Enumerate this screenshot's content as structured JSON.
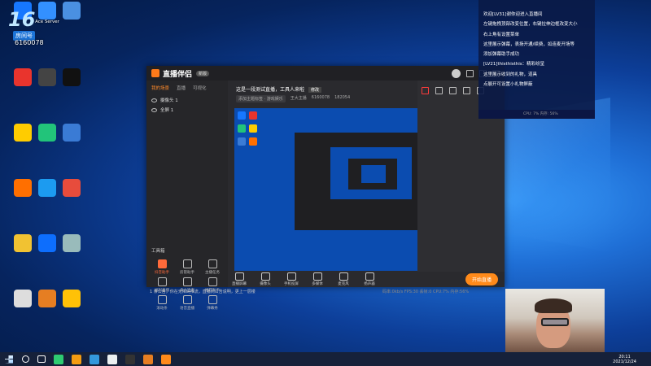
{
  "desktop_icons": [
    {
      "label": "",
      "color": "#1677ff"
    },
    {
      "label": "Ace Server",
      "color": "#3390ff"
    },
    {
      "label": "",
      "color": "#4a90e2"
    },
    {
      "label": "",
      "color": "#e9342d"
    },
    {
      "label": "",
      "color": "#444"
    },
    {
      "label": "",
      "color": "#111"
    },
    {
      "label": "",
      "color": "#ffcc00"
    },
    {
      "label": "",
      "color": "#22c47a"
    },
    {
      "label": "",
      "color": "#3a7bd5"
    },
    {
      "label": "",
      "color": "#ff6f00"
    },
    {
      "label": "",
      "color": "#1c9bf0"
    },
    {
      "label": "",
      "color": "#e74c3c"
    },
    {
      "label": "",
      "color": "#f1c232"
    },
    {
      "label": "",
      "color": "#0d6efd"
    },
    {
      "label": "",
      "color": "#9bb"
    },
    {
      "label": "",
      "color": "#ddd"
    },
    {
      "label": "",
      "color": "#e67e22"
    },
    {
      "label": "",
      "color": "#ffc107"
    }
  ],
  "overlay": {
    "number": "16",
    "tag": "房间号",
    "id": "6160078"
  },
  "app": {
    "name": "直播伴侣",
    "version_tag": "新版",
    "tabs": [
      "我的场景",
      "直播",
      "可视化"
    ],
    "scenes": [
      "摄像头 1",
      "全屏 1"
    ],
    "toolbox_title": "工具箱",
    "tools": [
      {
        "label": "抖音助手",
        "hot": true
      },
      {
        "label": "房管助手",
        "hot": false
      },
      {
        "label": "主播任务",
        "hot": false
      },
      {
        "label": "福利直播",
        "hot": false
      },
      {
        "label": "多人连麦",
        "hot": false
      },
      {
        "label": "推荐助手",
        "hot": false
      },
      {
        "label": "滚动条",
        "hot": false
      },
      {
        "label": "语音直播",
        "hot": false
      },
      {
        "label": "弹幕秀",
        "hot": false
      }
    ],
    "live_title": "这是一段测试直播，工具人来啦",
    "edit_label": "修改",
    "meta": [
      "添加主题标签 · 游戏娱乐",
      "王大主播",
      "6160078",
      "182054"
    ],
    "bottom_buttons": [
      "直播屏幕",
      "摄像头",
      "手机投屏",
      "多媒体",
      "麦克风",
      "扬声器"
    ],
    "start_label": "开始直播",
    "status_left": "1 条公告，你在无障碍推流，直播间公告说明，更上一层楼",
    "status_right": "码率:0kb/s  FPS:30  丢帧:0  CPU:7%  内存:56%"
  },
  "chat": {
    "lines": [
      "欢迎[LV31]谢你迎进入直播间",
      "左键拖拽顶部改变位置，右键拉伸边框改变大小",
      "右上角有设置菜单",
      "这里展示弹幕，表扬开通/续费，如连麦开场等",
      "添加弹幕助手成功",
      "[LV21]thisthisthis：精彩纷呈",
      "这里展示收到的礼物，道具",
      "点展开可设置小礼物屏蔽"
    ],
    "footer": "CPU: 7%  内存: 56%"
  },
  "taskbar": {
    "icons": [
      "#2ecc71",
      "#f39c12",
      "#3498db",
      "#ecf0f1",
      "#333",
      "#e67e22",
      "#ff8a1a"
    ],
    "time": "20:11",
    "date": "2021/12/24"
  }
}
